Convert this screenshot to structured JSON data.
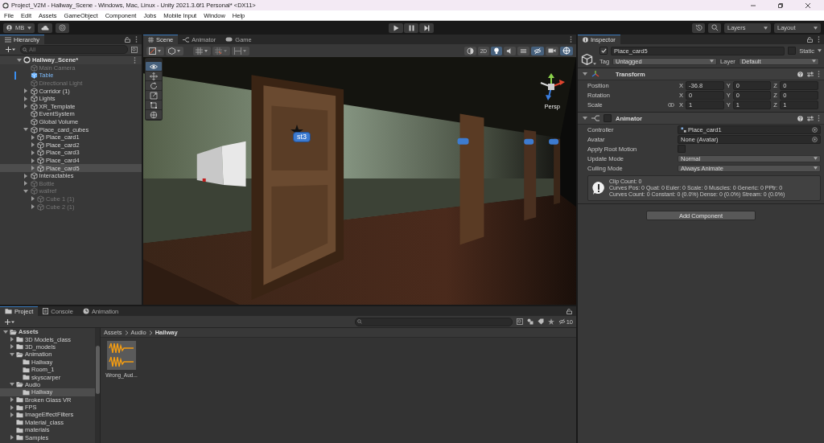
{
  "window": {
    "title": "Project_V2M - Hallway_Scene - Windows, Mac, Linux - Unity 2021.3.6f1 Personal* <DX11>"
  },
  "menu": [
    "File",
    "Edit",
    "Assets",
    "GameObject",
    "Component",
    "Jobs",
    "Mobile Input",
    "Window",
    "Help"
  ],
  "toolbar": {
    "account": "MB",
    "layers": "Layers",
    "layout": "Layout"
  },
  "hierarchy": {
    "title": "Hierarchy",
    "search_placeholder": "All",
    "root": {
      "label": "Hallway_Scene*",
      "kind": "scene",
      "expanded": true,
      "selected": false,
      "disabled": false,
      "children": [
        {
          "label": "Main Camera",
          "kind": "object",
          "selected": false,
          "disabled": true
        },
        {
          "label": "Table",
          "kind": "prefab",
          "selected": false,
          "disabled": false
        },
        {
          "label": "Directional Light",
          "kind": "object",
          "selected": false,
          "disabled": true
        },
        {
          "label": "Corridor (1)",
          "kind": "object",
          "expanded": false,
          "selected": false,
          "disabled": false
        },
        {
          "label": "Lights",
          "kind": "object",
          "expanded": false,
          "selected": false,
          "disabled": false
        },
        {
          "label": "XR_Template",
          "kind": "object",
          "expanded": false,
          "selected": false,
          "disabled": false
        },
        {
          "label": "EventSystem",
          "kind": "object",
          "selected": false,
          "disabled": false
        },
        {
          "label": "Global Volume",
          "kind": "object",
          "selected": false,
          "disabled": false
        },
        {
          "label": "Place_card_cubes",
          "kind": "object",
          "expanded": true,
          "selected": false,
          "disabled": false,
          "children": [
            {
              "label": "Place_card1",
              "kind": "object",
              "expanded": false,
              "selected": false,
              "disabled": false
            },
            {
              "label": "Place_card2",
              "kind": "object",
              "expanded": false,
              "selected": false,
              "disabled": false
            },
            {
              "label": "Place_card3",
              "kind": "object",
              "expanded": false,
              "selected": false,
              "disabled": false
            },
            {
              "label": "Place_card4",
              "kind": "object",
              "expanded": false,
              "selected": false,
              "disabled": false
            },
            {
              "label": "Place_card5",
              "kind": "object",
              "expanded": false,
              "selected": true,
              "disabled": false
            }
          ]
        },
        {
          "label": "Interactables",
          "kind": "object",
          "expanded": false,
          "selected": false,
          "disabled": false
        },
        {
          "label": "Bottle",
          "kind": "object",
          "expanded": false,
          "selected": false,
          "disabled": true
        },
        {
          "label": "wallref",
          "kind": "object",
          "expanded": true,
          "selected": false,
          "disabled": true,
          "children": [
            {
              "label": "Cube 1 (1)",
              "kind": "object",
              "expanded": false,
              "selected": false,
              "disabled": true
            },
            {
              "label": "Cube 2 (1)",
              "kind": "object",
              "expanded": false,
              "selected": false,
              "disabled": true
            }
          ]
        }
      ]
    }
  },
  "scene_view": {
    "tabs": [
      {
        "label": "Scene",
        "kind": "scene",
        "selected": true
      },
      {
        "label": "Animator",
        "kind": "animator",
        "selected": false
      },
      {
        "label": "Game",
        "kind": "game",
        "selected": false
      }
    ],
    "toggles": [
      {
        "kind": "shading",
        "on": false
      },
      {
        "kind": "dimension",
        "label": "2D",
        "on": false
      },
      {
        "kind": "lighting",
        "on": true
      },
      {
        "kind": "audio",
        "on": false
      },
      {
        "kind": "effects",
        "on": false
      },
      {
        "kind": "visibility",
        "on": true
      },
      {
        "kind": "camera",
        "on": false
      },
      {
        "kind": "gizmos",
        "on": true
      }
    ],
    "tools": [
      {
        "kind": "view",
        "selected": true
      },
      {
        "kind": "move",
        "selected": false
      },
      {
        "kind": "rotate",
        "selected": false
      },
      {
        "kind": "scale",
        "selected": false
      },
      {
        "kind": "rect",
        "selected": false
      },
      {
        "kind": "transform",
        "selected": false
      }
    ],
    "object_label": "st3",
    "projection": "Persp"
  },
  "inspector": {
    "title": "Inspector",
    "active": true,
    "name": "Place_card5",
    "static": false,
    "static_label": "Static",
    "tag_label": "Tag",
    "tag": "Untagged",
    "layer_label": "Layer",
    "layer": "Default",
    "components": [
      {
        "kind": "transform",
        "title": "Transform",
        "expanded": true,
        "rows": [
          {
            "label": "Position",
            "linked": false,
            "values": [
              {
                "axis": "X",
                "value": "-36.8"
              },
              {
                "axis": "Y",
                "value": "0"
              },
              {
                "axis": "Z",
                "value": "0"
              }
            ]
          },
          {
            "label": "Rotation",
            "linked": false,
            "values": [
              {
                "axis": "X",
                "value": "0"
              },
              {
                "axis": "Y",
                "value": "0"
              },
              {
                "axis": "Z",
                "value": "0"
              }
            ]
          },
          {
            "label": "Scale",
            "linked": true,
            "values": [
              {
                "axis": "X",
                "value": "1"
              },
              {
                "axis": "Y",
                "value": "1"
              },
              {
                "axis": "Z",
                "value": "1"
              }
            ]
          }
        ]
      },
      {
        "kind": "animator",
        "title": "Animator",
        "expanded": true,
        "enabled": false,
        "fields": [
          {
            "kind": "object",
            "label": "Controller",
            "value": "Place_card1"
          },
          {
            "kind": "object",
            "label": "Avatar",
            "value": "None (Avatar)"
          },
          {
            "kind": "checkbox",
            "label": "Apply Root Motion",
            "checked": false
          },
          {
            "kind": "dropdown",
            "label": "Update Mode",
            "value": "Normal"
          },
          {
            "kind": "dropdown",
            "label": "Culling Mode",
            "value": "Always Animate"
          }
        ],
        "info": [
          "Clip Count: 0",
          "Curves Pos: 0 Quat: 0 Euler: 0 Scale: 0 Muscles: 0 Generic: 0 PPtr: 0",
          "Curves Count: 0 Constant: 0 (0.0%) Dense: 0 (0.0%) Stream: 0 (0.0%)"
        ]
      }
    ],
    "add_component": "Add Component"
  },
  "project": {
    "tabs": [
      {
        "label": "Project",
        "kind": "project",
        "selected": true
      },
      {
        "label": "Console",
        "kind": "console",
        "selected": false
      },
      {
        "label": "Animation",
        "kind": "animation",
        "selected": false
      }
    ],
    "hidden_count": "10",
    "tree": {
      "label": "Assets",
      "expanded": true,
      "selected": false,
      "children": [
        {
          "label": "3D Models_class",
          "expanded": false,
          "selected": false
        },
        {
          "label": "3D_models",
          "expanded": false,
          "selected": false
        },
        {
          "label": "Animation",
          "expanded": true,
          "selected": false,
          "children": [
            {
              "label": "Hallway",
              "selected": false
            },
            {
              "label": "Room_1",
              "selected": false
            },
            {
              "label": "skyscarper",
              "selected": false
            }
          ]
        },
        {
          "label": "Audio",
          "expanded": true,
          "selected": false,
          "children": [
            {
              "label": "Hallway",
              "selected": true
            }
          ]
        },
        {
          "label": "Broken Glass VR",
          "expanded": false,
          "selected": false
        },
        {
          "label": "FPS",
          "expanded": false,
          "selected": false
        },
        {
          "label": "ImageEffectFilters",
          "expanded": false,
          "selected": false
        },
        {
          "label": "Material_class",
          "selected": false
        },
        {
          "label": "materials",
          "selected": false
        },
        {
          "label": "Samples",
          "expanded": false,
          "selected": false
        }
      ]
    },
    "breadcrumb": [
      "Assets",
      "Audio",
      "Hallway"
    ],
    "assets": [
      {
        "name": "Wrong_Aud..."
      }
    ]
  }
}
